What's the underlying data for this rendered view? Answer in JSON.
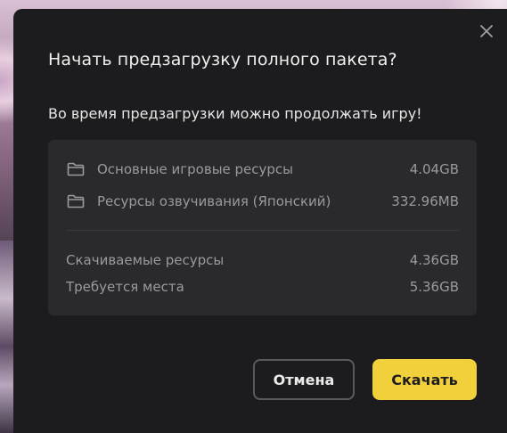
{
  "dialog": {
    "title": "Начать предзагрузку полного пакета?",
    "subtitle": "Во время предзагрузки можно продолжать игру!",
    "close_icon": "close-icon",
    "resources": [
      {
        "icon": "folder-icon",
        "label": "Основные игровые ресурсы",
        "size": "4.04GB"
      },
      {
        "icon": "folder-icon",
        "label": "Ресурсы озвучивания (Японский)",
        "size": "332.96MB"
      }
    ],
    "summary": [
      {
        "label": "Скачиваемые ресурсы",
        "value": "4.36GB"
      },
      {
        "label": "Требуется места",
        "value": "5.36GB"
      }
    ],
    "buttons": {
      "cancel_label": "Отмена",
      "download_label": "Скачать"
    },
    "colors": {
      "accent": "#f2d03c",
      "dialog_bg": "#1c1c1e",
      "panel_bg": "#2a2a2c"
    }
  }
}
